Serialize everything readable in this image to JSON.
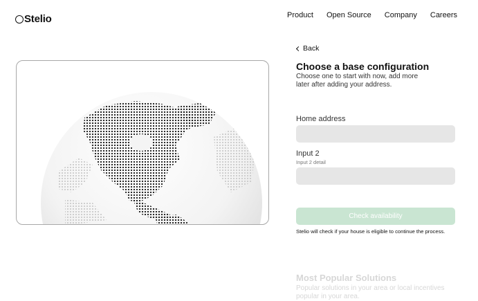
{
  "brand": {
    "name": "Stelio"
  },
  "nav": {
    "items": [
      "Product",
      "Open Source",
      "Company",
      "Careers"
    ]
  },
  "back": {
    "label": "Back"
  },
  "config": {
    "title": "Choose a base configuration",
    "subtitle": "Choose one to start with now, add more later after adding your address."
  },
  "fields": {
    "home_address": {
      "label": "Home address",
      "value": ""
    },
    "input2": {
      "label": "Input 2",
      "hint": "Input 2 detail",
      "value": ""
    }
  },
  "cta": {
    "label": "Check availability",
    "note": "Stelio will check if your house is eligible to continue the process."
  },
  "popular": {
    "title": "Most Popular Solutions",
    "subtitle": "Popular solutions in your area or local incentives popular in your area."
  },
  "colors": {
    "cta_bg": "#c9e5d2",
    "input_bg": "#e6e6e6",
    "faded_text": "#d7d7d7"
  }
}
